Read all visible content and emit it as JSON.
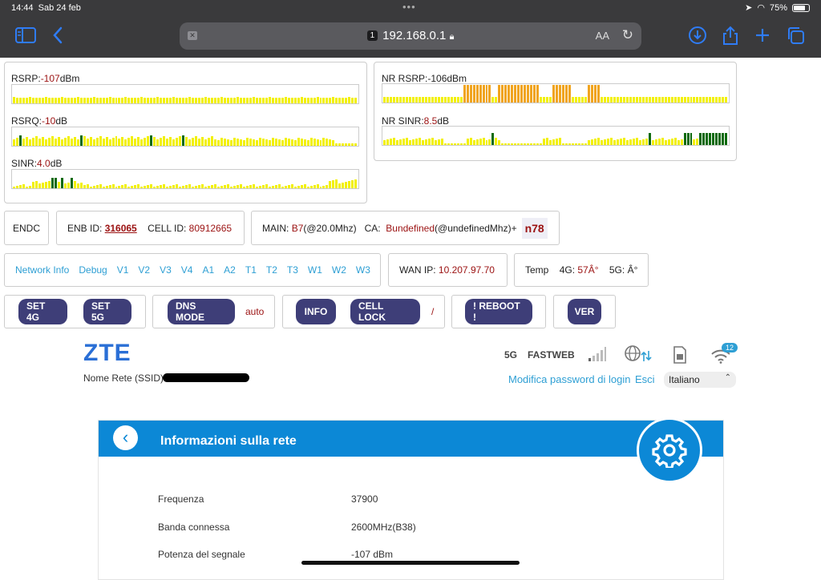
{
  "statusbar": {
    "time": "14:44",
    "date": "Sab 24 feb",
    "battery": "75%",
    "battery_level": 0.75
  },
  "browser": {
    "tab_number": "1",
    "url": "192.168.0.1",
    "text_size": "AA"
  },
  "signals": {
    "rsrp": {
      "label": "RSRP:",
      "value": "-107",
      "unit": "dBm"
    },
    "rsrq": {
      "label": "RSRQ:",
      "value": "-10",
      "unit": "dB"
    },
    "sinr": {
      "label": "SINR:",
      "value": "4.0",
      "unit": "dB"
    },
    "nr_rsrp": {
      "label": "NR RSRP:",
      "value": "-106",
      "unit": "dBm"
    },
    "nr_sinr": {
      "label": "NR SINR:",
      "value": "8.5",
      "unit": "dB"
    }
  },
  "colors": {
    "yellow": "#f2f000",
    "orange": "#f0a41f",
    "green": "#0d6a0d",
    "value_red": "#9b1111",
    "accent_blue": "#0c88d6",
    "link_blue": "#2e9fd4",
    "button": "#3e3e78"
  },
  "info_row": {
    "endc": "ENDC",
    "enb_label": "ENB ID:",
    "enb_value": "316065",
    "cell_label": "CELL ID:",
    "cell_value": "80912665",
    "main_label": "MAIN:",
    "main_band": "B7",
    "main_bw": "(@20.0Mhz)",
    "ca_label": "CA:",
    "ca_band": "Bundefined",
    "ca_bw": "(@undefinedMhz)+",
    "nr_band": "n78"
  },
  "nav_links": [
    "Network Info",
    "Debug",
    "V1",
    "V2",
    "V3",
    "V4",
    "A1",
    "A2",
    "T1",
    "T2",
    "T3",
    "W1",
    "W2",
    "W3"
  ],
  "wan": {
    "label": "WAN IP:",
    "value": "10.207.97.70"
  },
  "temp": {
    "label": "Temp",
    "g4_label": "4G:",
    "g4_value": "57Â°",
    "g5_label": "5G:",
    "g5_value": "Â°"
  },
  "buttons": {
    "set4g": "SET 4G",
    "set5g": "SET 5G",
    "dns": "DNS MODE",
    "dns_value": "auto",
    "info": "INFO",
    "cell_lock": "CELL LOCK",
    "cell_lock_value": "/",
    "reboot": "! REBOOT !",
    "ver": "VER"
  },
  "router": {
    "logo": "ZTE",
    "ssid_label": "Nome Rete (SSID):",
    "network_type": "5G",
    "operator": "FASTWEB",
    "wifi_clients": "12",
    "change_password": "Modifica password di login",
    "logout": "Esci",
    "language": "Italiano"
  },
  "card": {
    "title": "Informazioni sulla rete",
    "rows": [
      {
        "label": "Frequenza",
        "value": "37900"
      },
      {
        "label": "Banda connessa",
        "value": "2600MHz(B38)"
      },
      {
        "label": "Potenza del segnale",
        "value": "-107 dBm"
      }
    ]
  }
}
